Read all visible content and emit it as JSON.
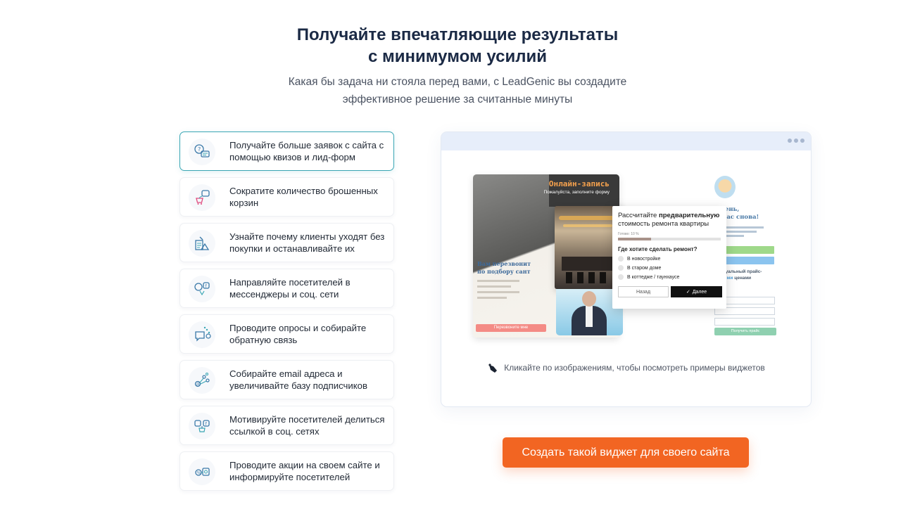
{
  "heading": {
    "line1": "Получайте впечатляющие результаты",
    "line2": "с минимумом усилий"
  },
  "subheading": {
    "line1": "Какая бы задача ни стояла перед вами, с LeadGenic вы создадите",
    "line2": "эффективное решение за считанные минуты"
  },
  "features": [
    {
      "label": "Получайте больше заявок с сайта с помощью квизов и лид-форм",
      "icon": "quiz-form-icon",
      "active": true
    },
    {
      "label": "Сократите количество брошенных корзин",
      "icon": "cart-chat-icon",
      "active": false
    },
    {
      "label": "Узнайте почему клиенты уходят без покупки и останавливайте их",
      "icon": "exit-intent-icon",
      "active": false
    },
    {
      "label": "Направляйте посетителей в мессенджеры и соц. сети",
      "icon": "messenger-icon",
      "active": false
    },
    {
      "label": "Проводите опросы и собирайте обратную связь",
      "icon": "survey-icon",
      "active": false
    },
    {
      "label": "Собирайте email адреса и увеличивайте базу подписчиков",
      "icon": "email-icon",
      "active": false
    },
    {
      "label": "Мотивируйте посетителей делиться ссылкой в соц. сетях",
      "icon": "share-icon",
      "active": false
    },
    {
      "label": "Проводите акции на своем сайте и информируйте посетителей",
      "icon": "promo-icon",
      "active": false
    }
  ],
  "preview": {
    "hint": "Кликайте по изображениям, чтобы посмотреть примеры виджетов",
    "cursor_icon": "hand-pointer-icon",
    "mock": {
      "card1_title": "Онлайн-запись",
      "card1_sub": "Пожалуйста, заполните форму",
      "card1_heading": "Вам перезвонит\nпо подбору сант",
      "card1_button": "Перезвоните мне",
      "quiz_title_plain": "Рассчитайте",
      "quiz_title_bold": "предварительную",
      "quiz_title_rest": "стоимость ремонта квартиры",
      "quiz_progress_label": "Готово: 10 %",
      "quiz_progress": 0.32,
      "quiz_question": "Где хотите сделать ремонт?",
      "quiz_options": [
        "В новостройке",
        "В старом доме",
        "В коттедже / таунхаусе"
      ],
      "quiz_back": "Назад",
      "quiz_next": "Далее",
      "card3_greeting": "й день,\nы вас снова!",
      "card3_offer_a": "е актуальный прайс-",
      "card3_offer_b": "льными",
      "card3_offer_c": "ценами",
      "card3_button": "Получить прайс"
    }
  },
  "cta": {
    "label": "Создать такой виджет для своего сайта"
  },
  "colors": {
    "accent": "#f26522",
    "active_border": "#3aa6b4",
    "heading": "#1b2a45"
  }
}
